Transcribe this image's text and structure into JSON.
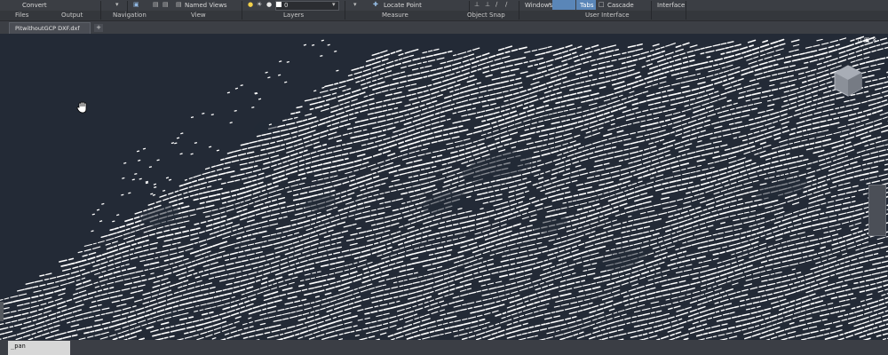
{
  "ribbon": {
    "controls": {
      "convert": "Convert",
      "named_views": "Named Views",
      "layer_value": "0",
      "locate_point": "Locate Point",
      "windows": "Windows",
      "tabs": "Tabs",
      "cascade": "Cascade",
      "interface": "Interface"
    },
    "panels": {
      "files": "Files",
      "output": "Output",
      "navigation": "Navigation",
      "view": "View",
      "layers": "Layers",
      "measure": "Measure",
      "object_snap": "Object Snap",
      "user_interface": "User Interface"
    }
  },
  "tabs": {
    "file_tab": "PitwithoutGCP DXF.dxf",
    "add_tab": "+"
  },
  "viewport": {
    "controls": "▫ ▣ ×",
    "cursor_icon": "pan-hand-icon",
    "viewcube_icon": "viewcube-icon"
  },
  "command_line": {
    "text": "_pan"
  },
  "colors": {
    "canvas": "#232a36",
    "points": "#ffffff",
    "ribbon": "#3b3e44",
    "tab_highlight": "#5a86b8"
  }
}
